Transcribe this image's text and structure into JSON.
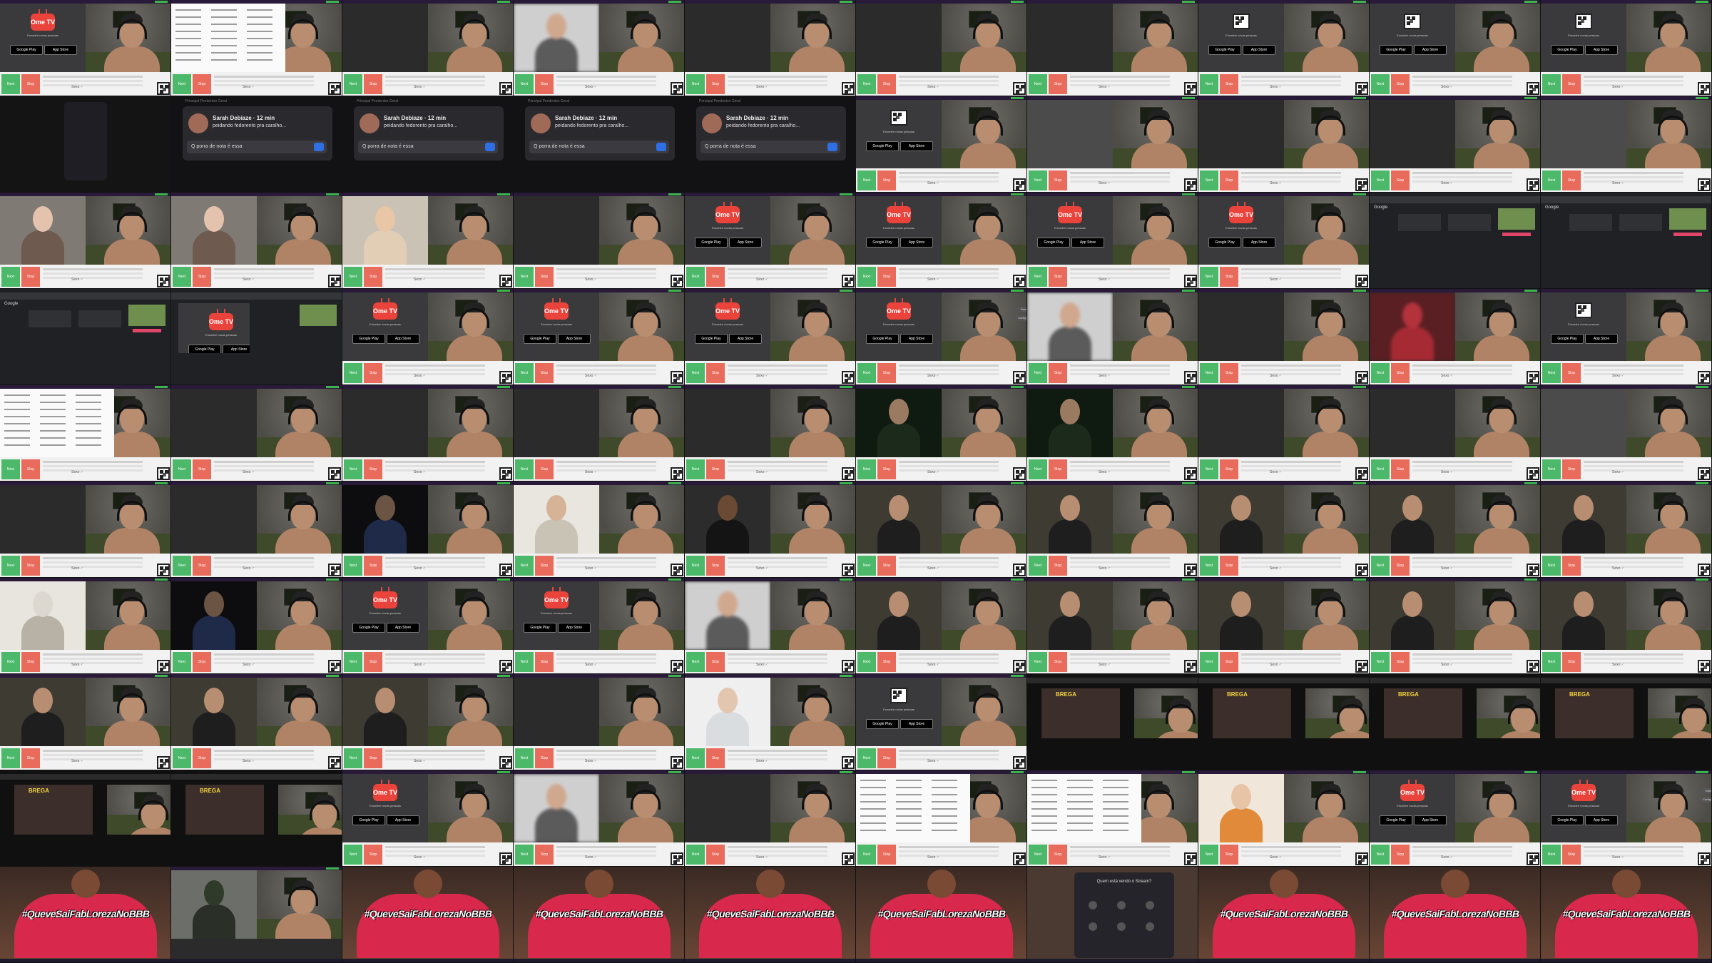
{
  "labels": {
    "next": "Next",
    "stop": "Stop",
    "flags": "Sexo ♂",
    "ome_logo": "Ome TV",
    "ome_sub": "Encontre novas pessoas",
    "google_play": "Google Play",
    "app_store": "App Store",
    "google": "Google",
    "notif_name": "Sarah Debiaze · 12 min",
    "notif_msg": "peidando fedorento pra caralho...",
    "notif_reply": "Q porra de nota é essa",
    "notif_tabs": "Principal   Pendentes   Geral",
    "banner_text": "#QueveSaiFabLorezaNoBBB",
    "player_title": "BREGA",
    "dialog_title": "Quem está vendo o Stream?",
    "report": "Denunciar",
    "configurations": "Configurações"
  },
  "grid": {
    "columns": 10,
    "rows": 10,
    "tiles": [
      [
        "promo",
        "menu",
        "stream",
        "blurface",
        "stream",
        "stream",
        "stream",
        "qrpromo",
        "qrpromo",
        "qrpromo"
      ],
      [
        "phone",
        "notif",
        "notif",
        "notif",
        "notif",
        "qrpromo",
        "fog",
        "stream",
        "stream",
        "fog"
      ],
      [
        "girl",
        "girl",
        "man",
        "stream",
        "promo",
        "promo",
        "promo",
        "promo",
        "google",
        "google"
      ],
      [
        "google",
        "promo2",
        "promo",
        "promo",
        "promo",
        "promopills",
        "blurface",
        "stream",
        "redblur",
        "qrpromo"
      ],
      [
        "menu",
        "stream",
        "stream",
        "stream",
        "stream",
        "hoodie",
        "hoodie",
        "stream",
        "stream",
        "fog"
      ],
      [
        "stream",
        "stream",
        "dude",
        "beard",
        "beanie",
        "guy",
        "guy",
        "guy",
        "guy",
        "guy"
      ],
      [
        "room",
        "dude",
        "promo",
        "promo",
        "blurface",
        "guy",
        "guy",
        "guy",
        "guy",
        "guy"
      ],
      [
        "guy",
        "guy",
        "guy",
        "stream",
        "guitar",
        "qrpromo",
        "player",
        "player",
        "player",
        "player"
      ],
      [
        "player",
        "player",
        "promo",
        "blurface",
        "stream",
        "menu",
        "menu",
        "arm",
        "promo",
        "promopills"
      ],
      [
        "banner",
        "bedroom",
        "banner",
        "banner",
        "banner",
        "banner",
        "dialog",
        "banner",
        "banner",
        "banner"
      ]
    ]
  }
}
